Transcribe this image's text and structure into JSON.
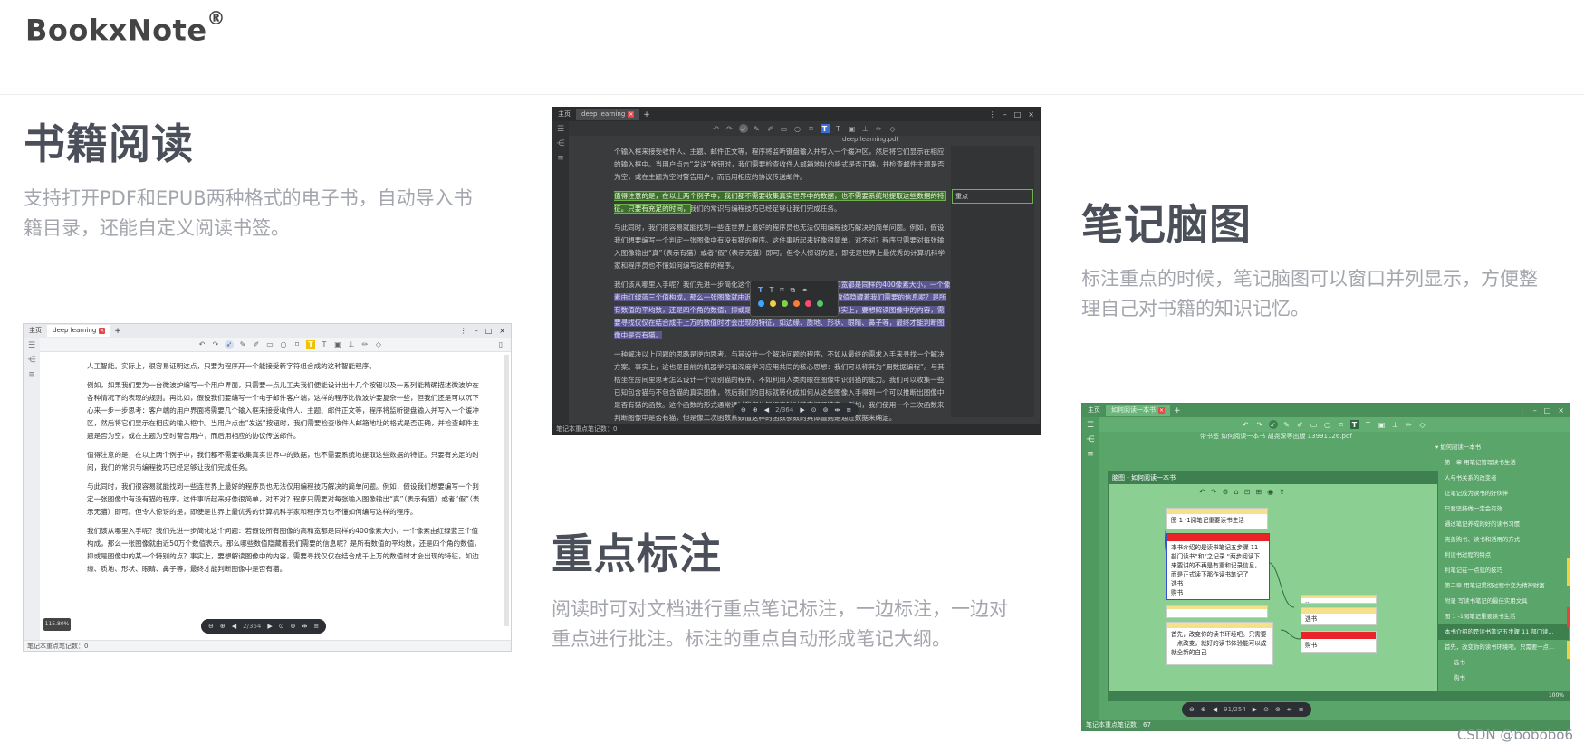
{
  "brand": {
    "name": "BookxNote",
    "mark": "®"
  },
  "sections": {
    "reading": {
      "title": "书籍阅读",
      "desc_line1": "支持打开PDF和EPUB两种格式的电子书，自动导入书",
      "desc_line2": "籍目录，还能自定义阅读书签。"
    },
    "highlight": {
      "title": "重点标注",
      "desc_line1": "阅读时可对文档进行重点笔记标注，一边标注，一边对",
      "desc_line2": "重点进行批注。标注的重点自动形成笔记大纲。"
    },
    "mindmap": {
      "title": "笔记脑图",
      "desc_line1": "标注重点的时候，笔记脑图可以窗口并列显示，方便整",
      "desc_line2": "理自己对书籍的知识记忆。"
    }
  },
  "win1": {
    "tabs": [
      "主页",
      "deep learning"
    ],
    "status": "笔记本重点笔记数：0",
    "zoom": "115.80%",
    "page": "2/364",
    "paragraphs": [
      "人工智能。实际上，很容易证明这点，只要为程序开一个能接受新字符组合成的这种智能程序。",
      "例如，如果我们要为一台微波炉编写一个用户界面，只需要一点儿工夫我们便能设计出十几个按钮以及一系列能精确描述微波炉在各种情况下的表现的规则。再比如，假设我们要编写一个电子邮件客户端，这样的程序比微波炉要复杂一些，但我们还是可以沉下心来一步一步思考：客户端的用户界面将需要几个输入框来接受收件人、主题、邮件正文等，程序将监听键盘输入并写入一个缓冲区，然后将它们显示在相应的输入框中。当用户点击“发送”按钮时，我们需要检查收件人邮箱地址的格式是否正确，并检查邮件主题是否为空，或在主题为空时警告用户，而后用相应的协议传送邮件。",
      "值得注意的是，在以上两个例子中，我们都不需要收集真实世界中的数据，也不需要系统地提取这些数据的特征。只要有充足的时间，我们的常识与编程技巧已经足够让我们完成任务。",
      "与此同时，我们很容易就能找到一些连世界上最好的程序员也无法仅用编程技巧解决的简单问题。例如，假设我们想要编写一个判定一张图像中有没有猫的程序。这件事听起来好像很简单，对不对？程序只需要对每张输入图像输出“真”（表示有猫）或者“假”（表示无猫）即可。但令人惊讶的是，即使是世界上最优秀的计算机科学家和程序员也不懂如何编写这样的程序。",
      "我们该从哪里入手呢？我们先进一步简化这个问题：若假设所有图像的高和宽都是同样的400像素大小，一个像素由红绿蓝三个值构成，那么一张图像就由近50万个数值表示。那么哪些数值隐藏着我们需要的信息呢？是所有数值的平均数，还是四个角的数值，抑或是图像中的某一个特别的点？事实上，要想解读图像中的内容，需要寻找仅仅在结合成千上万的数值时才会出现的特征，如边缘、质地、形状、眼睛、鼻子等，最终才能判断图像中是否有猫。"
    ]
  },
  "win2": {
    "tabs": [
      "主页",
      "deep learning"
    ],
    "doc_title": "deep learning.pdf",
    "status": "笔记本重点笔记数：0",
    "page": "2/364",
    "note_label": "重点",
    "p1": "个输入框来接受收件人、主题、邮件正文等，程序将监听键盘输入并写入一个缓冲区，然后将它们显示在相应的输入框中。当用户点击“发送”按钮时，我们需要检查收件人邮箱地址的格式是否正确，并检查邮件主题是否为空，或在主题为空时警告用户，而后用相应的协议传送邮件。",
    "p2_hl": "值得注意的是，在以上两个例子中，我们都不需要收集真实世界中的数据，也不需要系统地提取这些数据的特征。只要有充足的时间，",
    "p2_rest": "我们的常识与编程技巧已经足够让我们完成任务。",
    "p3": "与此同时，我们很容易就能找到一些连世界上最好的程序员也无法仅用编程技巧解决的简单问题。例如，假设我们想要编写一个判定一张图像中有没有猫的程序。这件事听起来好像很简单，对不对？程序只需要对每张输入图像输出“真”（表示有猫）或者“假”（表示无猫）即可。但令人惊讶的是，即使是世界上最优秀的计算机科学家和程序员也不懂如何编写这样的程序。",
    "p4_start": "我们该从哪里入手呢？我们先进一步简化这个问题：",
    "p4_hl": "若假设所有图像的高和宽都是同样的400像素大小，一个像素由红绿蓝三个值构成，那么一张图像就由近50万个数值表示。那么哪些数值隐藏着我们需要的信息呢？是所有数值的平均数，还是四个角的数值，抑或是图像中的某一个特别的点？事实上，要想解读图像中的内容，需要寻找仅仅在结合成千上万的数值时才会出现的特征，如边缘、质地、形状、眼睛、鼻子等，最终才能判断图像中是否有猫。",
    "p5": "一种解决以上问题的思路是逆向思考。与其设计一个解决问题的程序，不如从最终的需求入手来寻找一个解决方案。事实上，这也是目前的机器学习和深度学习应用共同的核心思想：我们可以称其为“用数据编程”。与其枯坐在房间里思考怎么设计一个识别猫的程序，不如利用人类肉眼在图像中识别猫的能力。我们可以收集一些已知包含猫与不包含猫的真实图像，然后我们的目标就转化成如何从这些图像入手得到一个可以推断出图像中是否有猫的函数。这个函数的形式通常通过我们的知识来针对特定问题选定。例如，我们使用一个二次函数来判断图像中是否有猫，但是像二次函数系数值这样的函数参数的具体值则是通过数据来确定。"
  },
  "win3": {
    "tabs": [
      "主页",
      "如何阅读一本书"
    ],
    "doc_title": "带书签 如何阅读一本书 胡尧深等出版 13991126.pdf",
    "mm_title": "脑图 - 如何阅读一本书",
    "status": "笔记本重点笔记数：67",
    "page": "91/254",
    "zoom": "100%",
    "nodes": {
      "n1": "图 1 -1阅笔记重要读书生活",
      "n2": "本书介绍的是读书笔记五步骤 11 部门读书“和”之记录 “两步阅读下来要讲的不再是有重和记录信息，而是正式读下那作读书笔记了",
      "n2_a": "选书",
      "n2_b": "购书",
      "n3": "首先，改变你的读书环境吧。只需要一点改变，就好的读书体验能可以成就全新的自己",
      "n4": "选书",
      "n5": "购书",
      "n_small1": "...",
      "n_small2": "..."
    },
    "outline": [
      "▾ 如何阅读一本书",
      "第一章 用笔记管理读书生活",
      "人与书关系的改变者",
      "让笔记成为读书的好伙伴",
      "只要坚持做一定会有效",
      "通过笔记养成的好的读书习惯",
      "完善购书、读书和活用的方式",
      "利读书过程的特点",
      "利笔记在一点就的技巧",
      "第二章 用笔记贯彻过程中变为精神财富",
      "附录 写读书笔记的最佳实用文具",
      "图 1 -1阅笔记重要读书生活",
      "本书介绍的是读书笔记五步骤 11 部门读...",
      "首先，改变你的读书环境吧。只需要一点...",
      "选书",
      "购书"
    ]
  },
  "watermark": "CSDN @bobobo6"
}
